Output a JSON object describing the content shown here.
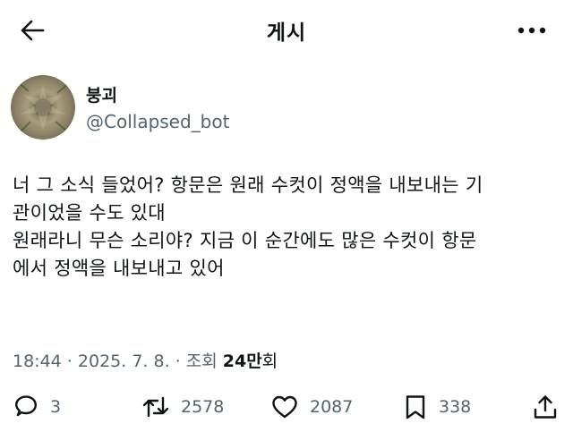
{
  "header": {
    "title": "게시"
  },
  "author": {
    "display_name": "붕괴",
    "handle": "@Collapsed_bot"
  },
  "tweet": {
    "text": "너 그 소식 들었어? 항문은 원래 수컷이 정액을 내보내는 기\n관이었을 수도 있대\n원래라니 무슨 소리야? 지금 이 순간에도 많은 수컷이 항문\n에서 정액을 내보내고 있어"
  },
  "meta": {
    "time": "18:44",
    "sep1": " · ",
    "date": "2025. 7. 8.",
    "sep2": " · ",
    "views_prefix": "조회 ",
    "views_count": "24만",
    "views_suffix": "회"
  },
  "actions": {
    "reply_count": "3",
    "retweet_count": "2578",
    "like_count": "2087",
    "bookmark_count": "338"
  },
  "icons": {
    "back": "arrow-left-icon",
    "more": "more-horizontal-icon",
    "reply": "speech-bubble-icon",
    "retweet": "retweet-icon",
    "like": "heart-icon",
    "bookmark": "bookmark-icon",
    "share": "share-upload-icon"
  },
  "colors": {
    "text": "#0f1419",
    "secondary": "#536471",
    "background": "#ffffff"
  }
}
